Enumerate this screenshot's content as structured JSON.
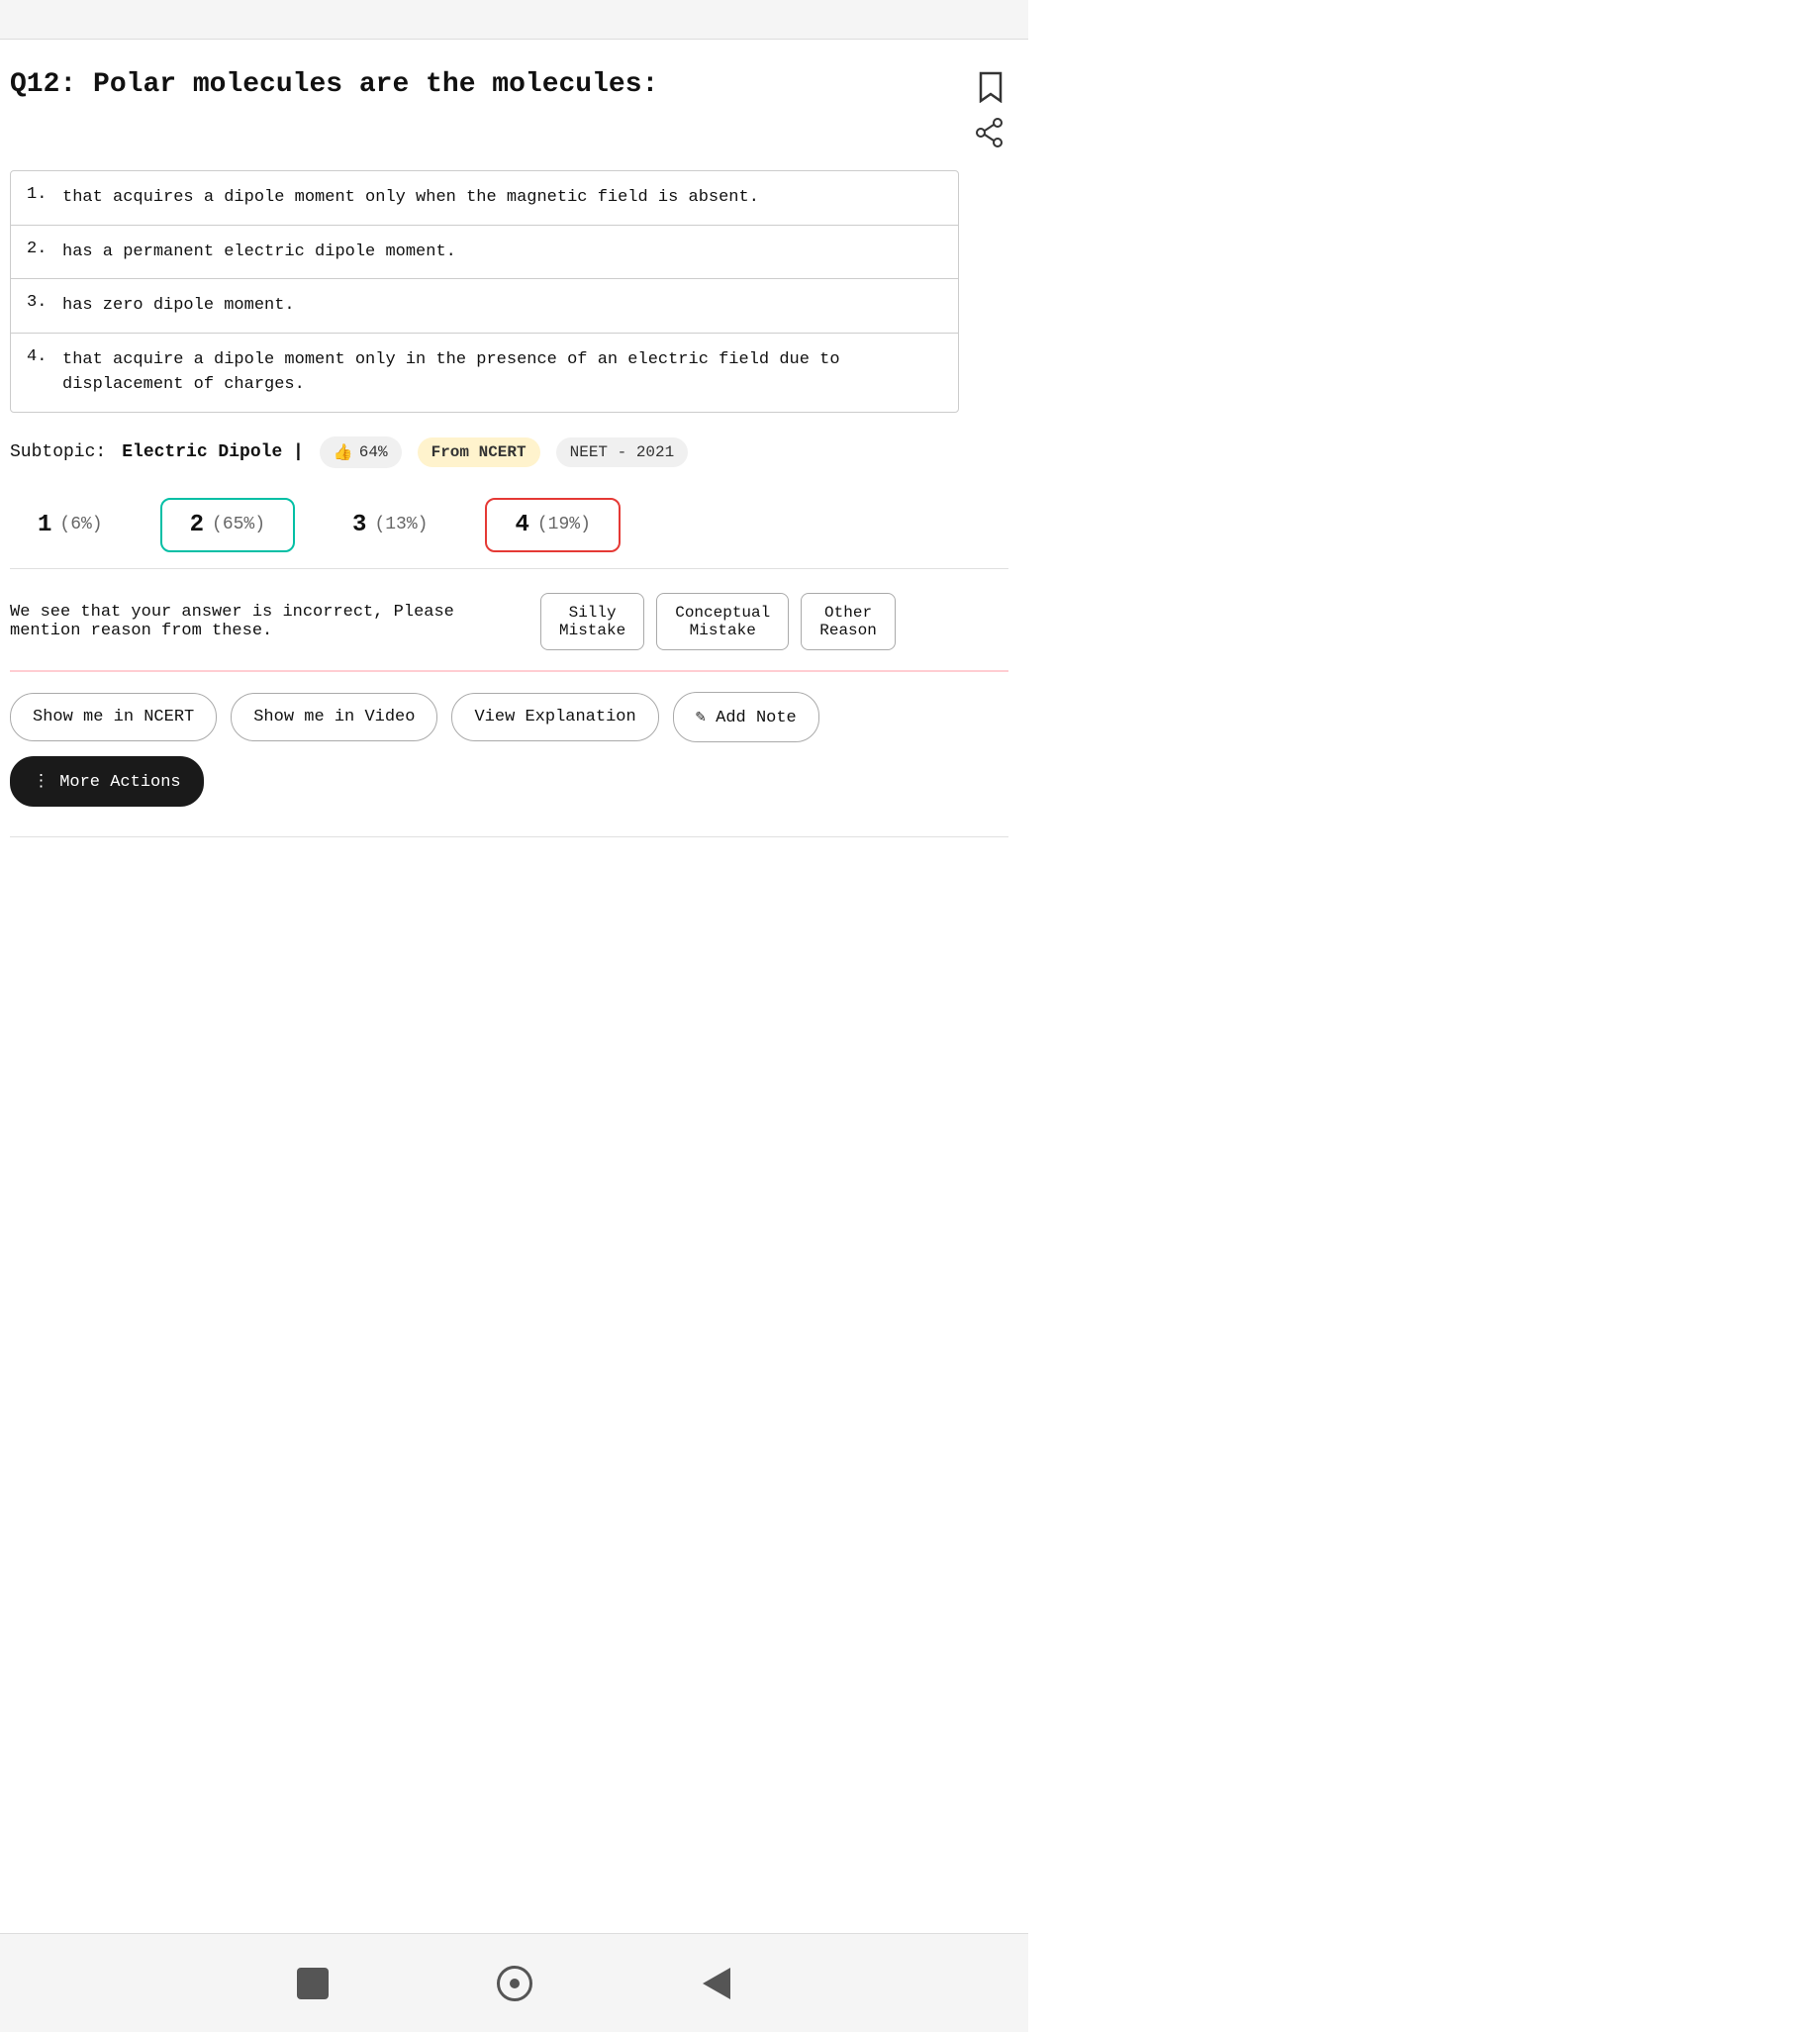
{
  "topbar": {},
  "question": {
    "number": "Q12:",
    "text": "Polar molecules are the molecules:",
    "options": [
      {
        "num": "1.",
        "text": "that acquires a dipole moment only when the magnetic field is absent."
      },
      {
        "num": "2.",
        "text": "has a permanent electric dipole moment."
      },
      {
        "num": "3.",
        "text": "has zero dipole moment."
      },
      {
        "num": "4.",
        "text": "that acquire a dipole moment only in the presence of an electric field due to displacement of charges."
      }
    ]
  },
  "subtopic": {
    "label": "Subtopic:",
    "value": "Electric Dipole |",
    "like_pct": "64%",
    "source": "From NCERT",
    "exam": "NEET - 2021"
  },
  "answers": [
    {
      "num": "1",
      "pct": "(6%)",
      "style": "normal"
    },
    {
      "num": "2",
      "pct": "(65%)",
      "style": "correct"
    },
    {
      "num": "3",
      "pct": "(13%)",
      "style": "normal"
    },
    {
      "num": "4",
      "pct": "(19%)",
      "style": "wrong"
    }
  ],
  "incorrect_section": {
    "text": "We see that your answer is incorrect, Please mention reason from these.",
    "reasons": [
      {
        "label": "Silly\nMistake"
      },
      {
        "label": "Conceptual\nMistake"
      },
      {
        "label": "Other\nReason"
      }
    ]
  },
  "actions": [
    {
      "label": "Show me in NCERT",
      "icon": ""
    },
    {
      "label": "Show me in Video",
      "icon": ""
    },
    {
      "label": "View Explanation",
      "icon": ""
    },
    {
      "label": "✎ Add Note",
      "icon": ""
    },
    {
      "label": "⋮ More Actions",
      "dark": true
    }
  ],
  "icons": {
    "bookmark": "🔖",
    "share": "⬆"
  },
  "nav": {
    "square_label": "stop",
    "circle_label": "home",
    "back_label": "back"
  }
}
